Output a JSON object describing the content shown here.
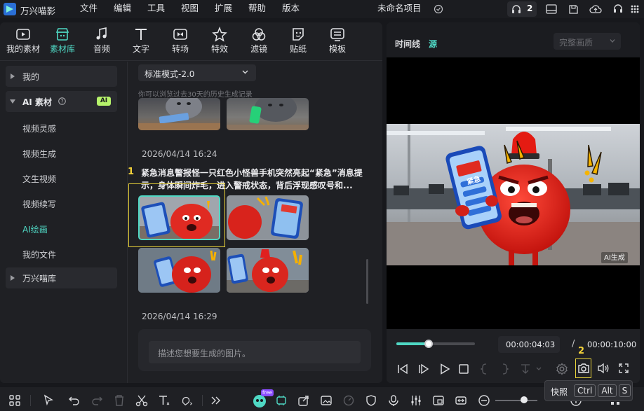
{
  "app": {
    "title": "万兴喵影"
  },
  "menu": [
    "文件",
    "编辑",
    "工具",
    "视图",
    "扩展",
    "帮助",
    "版本"
  ],
  "project": {
    "name": "未命名项目",
    "badge_count": "2"
  },
  "tabs": [
    {
      "label": "我的素材"
    },
    {
      "label": "素材库"
    },
    {
      "label": "音频"
    },
    {
      "label": "文字"
    },
    {
      "label": "转场"
    },
    {
      "label": "特效"
    },
    {
      "label": "滤镜"
    },
    {
      "label": "贴纸"
    },
    {
      "label": "模板"
    }
  ],
  "sidebar": {
    "mine": "我的",
    "ai_section": "AI 素材",
    "ai_badge": "AI",
    "items": [
      "视频灵感",
      "视频生成",
      "文生视频",
      "视频续写",
      "AI绘画",
      "我的文件"
    ],
    "library": "万兴喵库"
  },
  "gen": {
    "mode": "标准模式-2.0",
    "history_note": "你可以浏览过去30天的历史生成记录",
    "group1_date": "2026/04/14 16:24",
    "prompt_line1": "紧急消息警报怪一只红色小怪兽手机突然亮起“紧急”消息提",
    "prompt_line2": "示，身体瞬间炸毛，进入警戒状态，背后浮现感叹号和...",
    "group2_date": "2026/04/14 16:29",
    "input_placeholder": "描述您想要生成的图片。",
    "annotation_1": "1",
    "phone_text": "紧急"
  },
  "preview": {
    "timeline_label": "时间线",
    "source_label": "源",
    "quality": "完整画质",
    "watermark": "AI生成",
    "current_time": "00:00:04:03",
    "separator": "/",
    "total_time": "00:00:10:00",
    "progress": 0.41,
    "annotation_2": "2"
  },
  "tooltip": {
    "label": "快照",
    "keys": [
      "Ctrl",
      "Alt",
      "S"
    ]
  },
  "bottom": {
    "free_badge": "free"
  }
}
